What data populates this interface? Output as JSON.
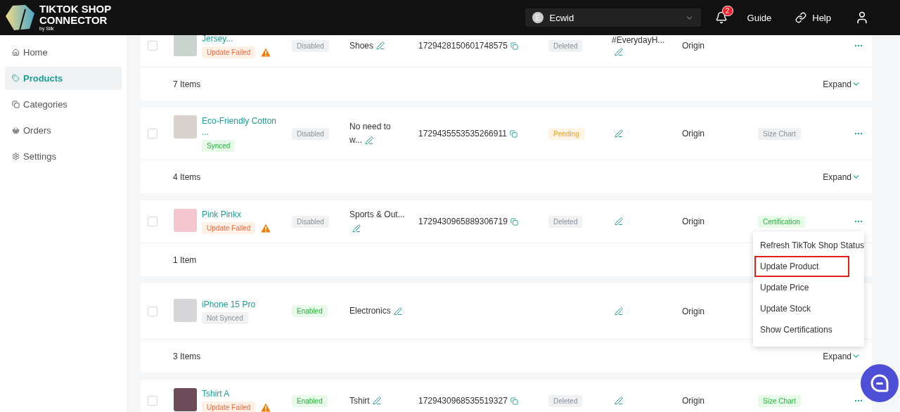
{
  "header": {
    "logo": {
      "line1": "TIKTOK SHOP",
      "line2": "CONNECTOR",
      "by": "by Silk"
    },
    "store": {
      "initial": "E",
      "name": "Ecwid"
    },
    "notifications": "2",
    "links": [
      {
        "kind": "guide",
        "label": "Guide"
      },
      {
        "kind": "help",
        "label": "Help"
      }
    ]
  },
  "sidebar": [
    {
      "label": "Home",
      "selected": false
    },
    {
      "label": "Products",
      "selected": true
    },
    {
      "label": "Categories",
      "selected": false
    },
    {
      "label": "Orders",
      "selected": false
    },
    {
      "label": "Settings",
      "selected": false
    }
  ],
  "groups": [
    {
      "product": {
        "checked": false,
        "name": "Jersey...",
        "sync": {
          "label": "Update Failed",
          "kind": "failed"
        },
        "warning": true,
        "status": {
          "label": "Disabled",
          "kind": "disabled"
        },
        "category": "Shoes",
        "tiktok_id": "1729428150601748575",
        "tiktok_status": {
          "label": "Deleted",
          "kind": "deleted"
        },
        "tag": "#EverydayH...",
        "origin": "Origin"
      },
      "count": "7 Items",
      "expand": "Expand"
    },
    {
      "product": {
        "checked": false,
        "name": "Eco-Friendly Cotton ...",
        "sync": {
          "label": "Synced",
          "kind": "synced"
        },
        "warning": false,
        "status": {
          "label": "Disabled",
          "kind": "disabled"
        },
        "category": "No need to w...",
        "tiktok_id": "1729435553535266911",
        "tiktok_status": {
          "label": "Pending",
          "kind": "pending"
        },
        "origin": "Origin",
        "certificate": {
          "label": "Size Chart",
          "kind": "inactive"
        }
      },
      "count": "4 Items",
      "expand": "Expand"
    },
    {
      "product": {
        "checked": false,
        "name": "Pink Pinkx",
        "sync": {
          "label": "Update Failed",
          "kind": "failed"
        },
        "warning": true,
        "status": {
          "label": "Disabled",
          "kind": "disabled"
        },
        "category": "Sports & Out...",
        "tiktok_id": "1729430965889306719",
        "tiktok_status": {
          "label": "Deleted",
          "kind": "deleted"
        },
        "origin": "Origin",
        "certificate": {
          "label": "Certification",
          "kind": "active"
        }
      },
      "count": "1 Item"
    },
    {
      "product": {
        "checked": false,
        "name": "iPhone 15 Pro",
        "sync": {
          "label": "Not Synced",
          "kind": "not_synced"
        },
        "warning": false,
        "status": {
          "label": "Enabled",
          "kind": "enabled"
        },
        "category": "Electronics",
        "origin": "Origin"
      },
      "count": "3 Items",
      "expand": "Expand"
    },
    {
      "product": {
        "checked": false,
        "name": "Tshirt A",
        "sync": {
          "label": "Update Failed",
          "kind": "failed"
        },
        "warning": true,
        "status": {
          "label": "Enabled",
          "kind": "enabled"
        },
        "category": "Tshirt",
        "tiktok_id": "1729430968535519327",
        "tiktok_status": {
          "label": "Deleted",
          "kind": "deleted"
        },
        "origin": "Origin",
        "certificate": {
          "label": "Size Chart",
          "kind": "active"
        }
      }
    }
  ],
  "action_menu": {
    "items": [
      {
        "label": "Refresh TikTok Shop Status",
        "highlighted": false
      },
      {
        "label": "Update Product",
        "highlighted": true
      },
      {
        "label": "Update Price",
        "highlighted": false
      },
      {
        "label": "Update Stock",
        "highlighted": false
      },
      {
        "label": "Show Certifications",
        "highlighted": false
      }
    ]
  }
}
